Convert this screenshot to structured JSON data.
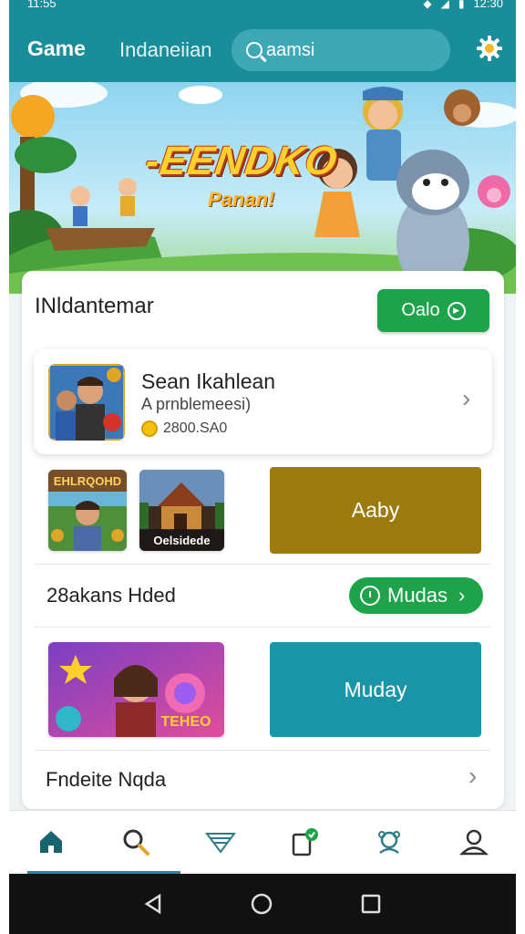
{
  "status_bar": {
    "time": "11:55",
    "right_time": "12:30"
  },
  "app_bar": {
    "title": "Game",
    "subtitle": "Indaneiian",
    "search_text": "aamsi"
  },
  "banner": {
    "title": "-EENDKO",
    "subtitle": "Panan!"
  },
  "section": {
    "title": "INldantemar",
    "button_label": "Oalo"
  },
  "featured": {
    "title": "Sean Ikahlean",
    "subtitle": "A prnblemeesi)",
    "coins": "2800.SA0"
  },
  "row1": {
    "thumb1_label": "EHLRQOHD",
    "thumb2_label": "Oelsidede",
    "tile_label": "Aaby",
    "tile_color": "#9b7a0f"
  },
  "row2": {
    "title": "28akans Hded",
    "button_label": "Mudas"
  },
  "row3": {
    "thumb_label": "TEHEO",
    "tile_label": "Muday",
    "tile_color": "#1a95a8"
  },
  "row4": {
    "title": "Fndeite Nqda"
  },
  "bottom_nav": [
    "home-icon",
    "search-icon",
    "filter-icon",
    "task-icon",
    "award-icon",
    "profile-icon"
  ],
  "colors": {
    "teal": "#1a8d9a",
    "green": "#1fa34a"
  }
}
